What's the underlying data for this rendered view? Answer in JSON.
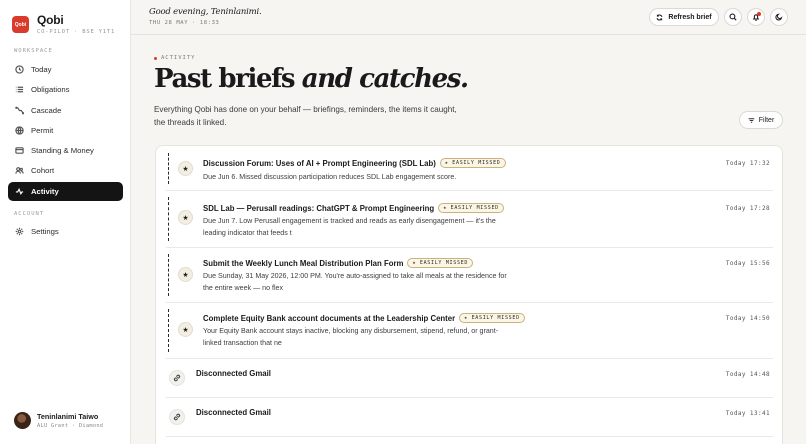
{
  "brand": {
    "logo_text": "Qobi",
    "name": "Qobi",
    "subtitle": "CO-PILOT · BSE Y1T1"
  },
  "sidebar": {
    "workspace_label": "WORKSPACE",
    "account_label": "ACCOUNT",
    "items": [
      {
        "label": "Today",
        "icon": "clock-icon"
      },
      {
        "label": "Obligations",
        "icon": "list-icon"
      },
      {
        "label": "Cascade",
        "icon": "cascade-icon"
      },
      {
        "label": "Permit",
        "icon": "globe-icon"
      },
      {
        "label": "Standing & Money",
        "icon": "card-icon"
      },
      {
        "label": "Cohort",
        "icon": "people-icon"
      },
      {
        "label": "Activity",
        "icon": "activity-icon",
        "active": true
      }
    ],
    "account_items": [
      {
        "label": "Settings",
        "icon": "gear-icon"
      }
    ]
  },
  "user": {
    "name": "Teninlanimi Taiwo",
    "subtitle": "ALU Grant · Diamond"
  },
  "header": {
    "greeting": "Good evening, Teninlanimi.",
    "date": "THU 28 MAY · 18:33",
    "refresh_label": "Refresh brief"
  },
  "page": {
    "eyebrow": "ACTIVITY",
    "title_main": "Past briefs",
    "title_italic": "and catches.",
    "intro": "Everything Qobi has done on your behalf — briefings, reminders, the items it caught, the threads it linked.",
    "filter_label": "Filter"
  },
  "activity": [
    {
      "title": "Discussion Forum: Uses of AI + Prompt Engineering (SDL Lab)",
      "badge": "EASILY MISSED",
      "desc": "Due Jun 6. Missed discussion participation reduces SDL Lab engagement score.",
      "time": "Today 17:32"
    },
    {
      "title": "SDL Lab — Perusall readings: ChatGPT & Prompt Engineering",
      "badge": "EASILY MISSED",
      "desc": "Due Jun 7. Low Perusall engagement is tracked and reads as early disengagement — it's the leading indicator that feeds t",
      "time": "Today 17:28"
    },
    {
      "title": "Submit the Weekly Lunch Meal Distribution Plan Form",
      "badge": "EASILY MISSED",
      "desc": "Due Sunday, 31 May 2026, 12:00 PM. You're auto-assigned to take all meals at the residence for the entire week — no flex",
      "time": "Today 15:56"
    },
    {
      "title": "Complete Equity Bank account documents at the Leadership Center",
      "badge": "EASILY MISSED",
      "desc": "Your Equity Bank account stays inactive, blocking any disbursement, stipend, refund, or grant-linked transaction that ne",
      "time": "Today 14:50"
    },
    {
      "title": "Disconnected Gmail",
      "time": "Today 14:48"
    },
    {
      "title": "Disconnected Gmail",
      "time": "Today 13:41"
    }
  ]
}
